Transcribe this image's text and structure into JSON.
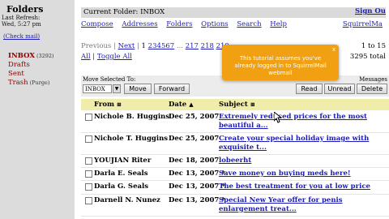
{
  "sidebar": {
    "title": "Folders",
    "last_refresh": "Last Refresh:",
    "refresh_time": "Wed, 5:27 pm",
    "check_mail": "(Check mail)",
    "folders": [
      {
        "name": "INBOX",
        "count": "(3292)",
        "active": true
      },
      {
        "name": "Drafts",
        "count": ""
      },
      {
        "name": "Sent",
        "count": ""
      },
      {
        "name": "Trash",
        "count": "(Purge)"
      }
    ]
  },
  "header": {
    "current_folder": "Current Folder: INBOX",
    "sign_out": "Sign Ou"
  },
  "nav": {
    "links": [
      "Compose",
      "Addresses",
      "Folders",
      "Options",
      "Search",
      "Help"
    ],
    "brand": "SquirrelMa"
  },
  "pager": {
    "previous": "Previous",
    "next": "Next",
    "pages": [
      "1",
      "2",
      "3",
      "4",
      "5",
      "6",
      "7",
      "...",
      "217",
      "218",
      "219",
      "220",
      "221"
    ],
    "viewing": "1 to 15",
    "all": "All",
    "toggle_all": "Toggle All",
    "size": "3295 total"
  },
  "actions": {
    "move_label": "Move Selected To:",
    "messages_label": "Messages",
    "folder_select": "INBOX",
    "move": "Move",
    "forward": "Forward",
    "read": "Read",
    "unread": "Unread",
    "delete": "Delete"
  },
  "table": {
    "headers": {
      "from": "From",
      "date": "Date",
      "subject": "Subject"
    },
    "rows": [
      {
        "from": "Nichole B. Huggins",
        "date": "Dec 25, 2007",
        "subject": "Extremely reduced prices for the most beautiful a...",
        "tall": true
      },
      {
        "from": "Nichole T. Huggins",
        "date": "Dec 25, 2007",
        "subject": "Create your special holiday image with exquisite t...",
        "tall": true
      },
      {
        "from": "YOUJIAN Riter",
        "date": "Dec 18, 2007",
        "subject": "lobeerht",
        "tall": false
      },
      {
        "from": "Darla E. Seals",
        "date": "Dec 13, 2007 *",
        "subject": "Save money on buying meds here!",
        "tall": false
      },
      {
        "from": "Darla G. Seals",
        "date": "Dec 13, 2007 *",
        "subject": "The best treatment for you at low price",
        "tall": false
      },
      {
        "from": "Darnell N. Nunez",
        "date": "Dec 13, 2007 *",
        "subject": "Special New Year offer for penis enlargement treat...",
        "tall": true
      }
    ]
  },
  "tooltip": {
    "text": "This tutorial assumes you've already logged in to SquirrelMail webmail",
    "close": "x"
  },
  "colors": {
    "accent": "#1b1bb8",
    "folder": "#8a0000",
    "header_bg": "#f0ecaa",
    "tooltip": "#f0a010"
  }
}
